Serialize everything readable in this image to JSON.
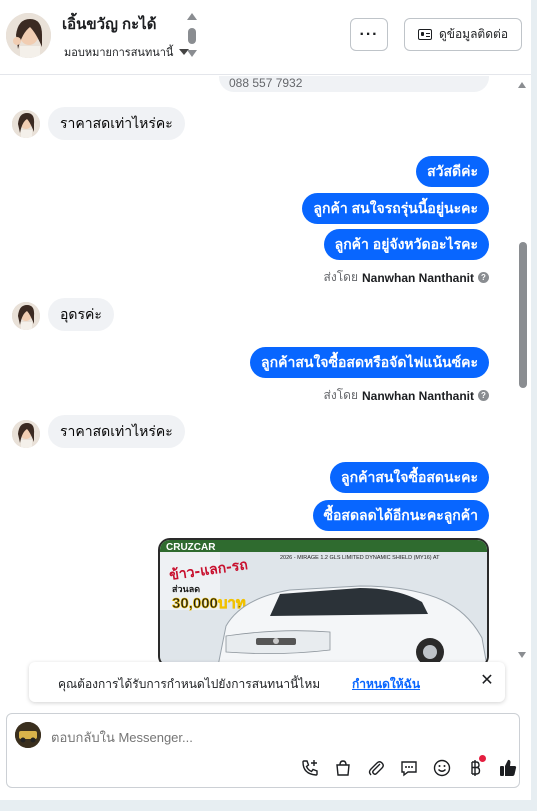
{
  "header": {
    "contact_name": "เอิ้นขวัญ กะได้",
    "assign_label": "มอบหมายการสนทนานี้",
    "more_label": "···",
    "contact_info_label": "ดูข้อมูลติดต่อ"
  },
  "thread": {
    "phone_fragment": "088 557 7932",
    "messages": [
      {
        "dir": "in",
        "text": "ราคาสดเท่าไหร่คะ"
      },
      {
        "dir": "out",
        "text": "สวัสดีค่ะ"
      },
      {
        "dir": "out",
        "text": "ลูกค้า สนใจรถรุ่นนี้อยู่นะคะ"
      },
      {
        "dir": "out",
        "text": "ลูกค้า อยู่จังหวัดอะไรคะ"
      },
      {
        "dir": "in",
        "text": "อุดรค่ะ"
      },
      {
        "dir": "out",
        "text": "ลูกค้าสนใจซื้อสดหรือจัดไฟแน้นซ์คะ"
      },
      {
        "dir": "in",
        "text": "ราคาสดเท่าไหร่คะ"
      },
      {
        "dir": "out",
        "text": "ลูกค้าสนใจซื้อสดนะคะ"
      },
      {
        "dir": "out",
        "text": "ซื้อสดลดได้อีกนะคะลูกค้า"
      }
    ],
    "sent_by_prefix": "ส่งโดย",
    "sent_by_name": "Nanwhan Nanthanit",
    "photo": {
      "banner_top": "CRUZCAR",
      "model_line": "2026 - MIRAGE 1.2 GLS LIMITED DYNAMIC SHIELD (MY16) AT",
      "promo_line1": "ข้าว-แลก-รถ",
      "promo_line2": "ส่วนลด",
      "promo_amount": "30,000บาท"
    }
  },
  "notice": {
    "text": "คุณต้องการได้รับการกำหนดไปยังการสนทนานี้ไหม",
    "link": "กำหนดให้ฉัน",
    "close": "✕"
  },
  "composer": {
    "placeholder": "ตอบกลับใน Messenger..."
  },
  "colors": {
    "accent": "#0866ff",
    "incoming_bubble": "#f0f2f5",
    "notification_dot": "#e41e3f"
  }
}
